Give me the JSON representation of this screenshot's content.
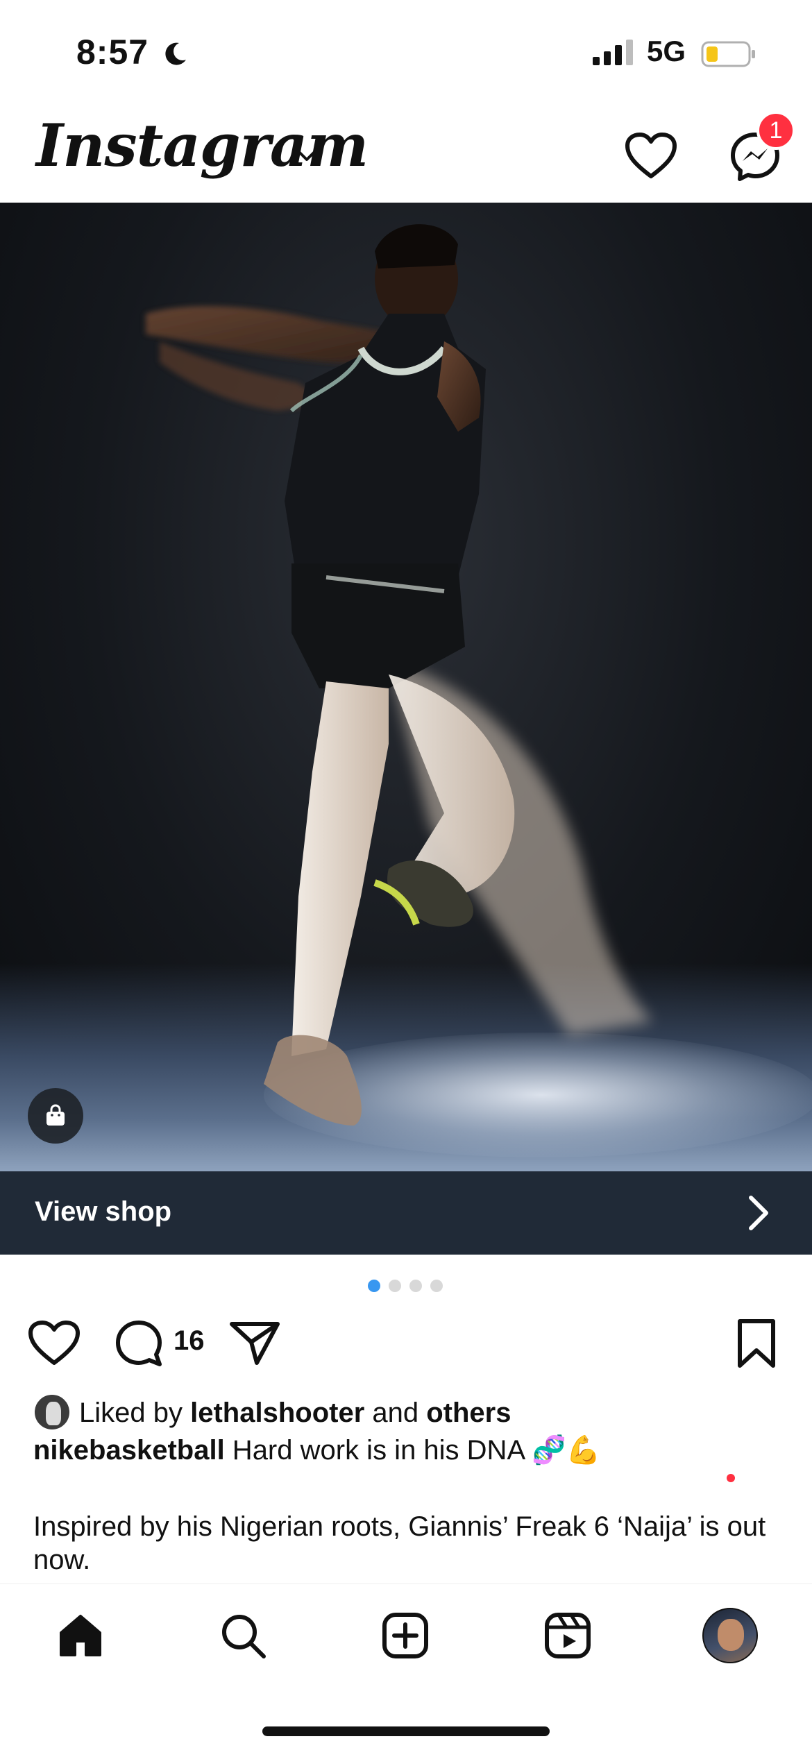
{
  "status_bar": {
    "time": "8:57",
    "network": "5G",
    "icons": [
      "moon-icon",
      "signal-icon",
      "battery-icon"
    ]
  },
  "header": {
    "logo": "Instagram",
    "message_badge_count": "1",
    "icons": [
      "chevron-down-icon",
      "heart-icon",
      "messenger-icon"
    ]
  },
  "post": {
    "image_description_icon": "shop-bag-icon",
    "view_shop_label": "View shop",
    "carousel": {
      "total": 4,
      "active_index": 0
    },
    "comment_count": "16",
    "liked_by_prefix": "Liked by ",
    "liked_by_user": "lethalshooter",
    "liked_by_middle": " and ",
    "liked_by_suffix": "others",
    "caption_username": "nikebasketball",
    "caption_text": " Hard work is in his DNA 🧬💪",
    "caption_body": "Inspired by his Nigerian roots, Giannis’ Freak 6 ‘Naija’ is out now."
  },
  "bottom_nav": {
    "icons": [
      "home-icon",
      "search-icon",
      "create-icon",
      "reels-icon",
      "profile-avatar"
    ]
  },
  "colors": {
    "accent_blue": "#3897f0",
    "badge_red": "#ff3040",
    "view_shop_bg": "#202a37"
  }
}
